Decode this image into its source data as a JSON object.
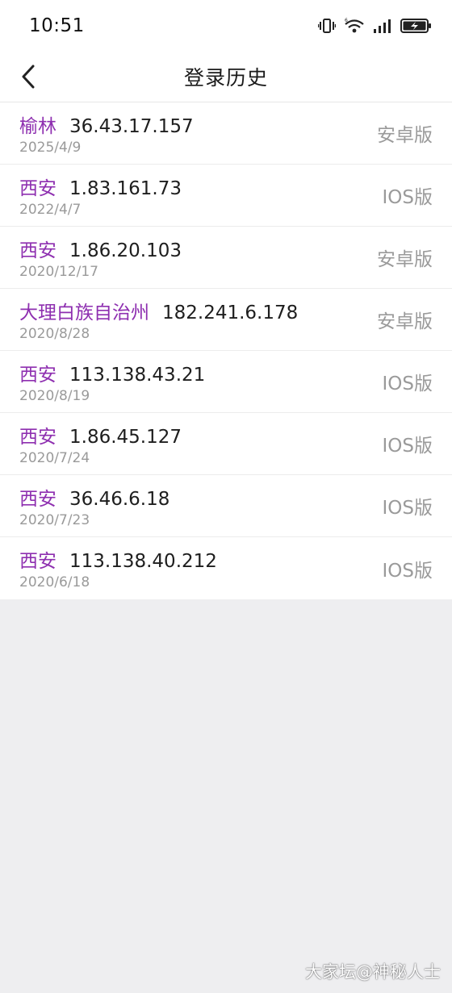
{
  "status_bar": {
    "time": "10:51",
    "icons": [
      "vibrate-icon",
      "wifi-6-icon",
      "signal-icon",
      "battery-charging-icon"
    ]
  },
  "header": {
    "back_icon": "chevron-left-icon",
    "title": "登录历史"
  },
  "login_history": [
    {
      "city": "榆林",
      "ip": "36.43.17.157",
      "date": "2025/4/9",
      "platform": "安卓版"
    },
    {
      "city": "西安",
      "ip": "1.83.161.73",
      "date": "2022/4/7",
      "platform": "IOS版"
    },
    {
      "city": "西安",
      "ip": "1.86.20.103",
      "date": "2020/12/17",
      "platform": "安卓版"
    },
    {
      "city": "大理白族自治州",
      "ip": "182.241.6.178",
      "date": "2020/8/28",
      "platform": "安卓版"
    },
    {
      "city": "西安",
      "ip": "113.138.43.21",
      "date": "2020/8/19",
      "platform": "IOS版"
    },
    {
      "city": "西安",
      "ip": "1.86.45.127",
      "date": "2020/7/24",
      "platform": "IOS版"
    },
    {
      "city": "西安",
      "ip": "36.46.6.18",
      "date": "2020/7/23",
      "platform": "IOS版"
    },
    {
      "city": "西安",
      "ip": "113.138.40.212",
      "date": "2020/6/18",
      "platform": "IOS版"
    }
  ],
  "watermark": "大家坛@神秘人士",
  "colors": {
    "city": "#8e2fb0",
    "ip": "#1e1e1e",
    "muted": "#9a9a9a",
    "page_background": "#eeeef0"
  }
}
